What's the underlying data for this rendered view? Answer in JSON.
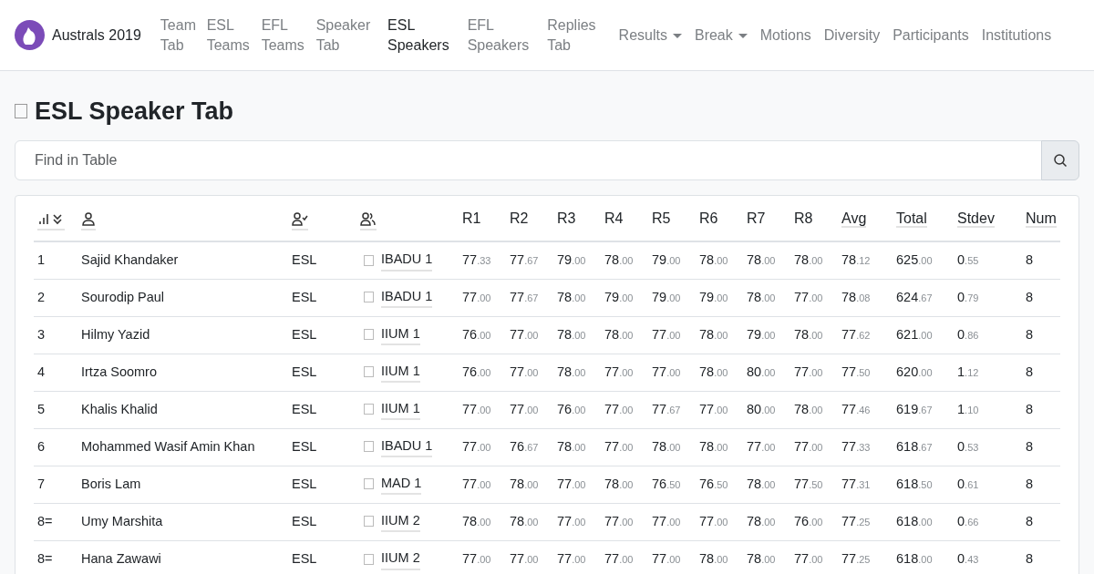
{
  "navbar": {
    "brand": "Australs 2019",
    "items": [
      {
        "label": "Team Tab",
        "selected": false,
        "dropdown": false
      },
      {
        "label": "ESL Teams",
        "selected": false,
        "dropdown": false
      },
      {
        "label": "EFL Teams",
        "selected": false,
        "dropdown": false
      },
      {
        "label": "Speaker Tab",
        "selected": false,
        "dropdown": false
      },
      {
        "label": "ESL Speakers",
        "selected": true,
        "dropdown": false
      },
      {
        "label": "EFL Speakers",
        "selected": false,
        "dropdown": false
      },
      {
        "label": "Replies Tab",
        "selected": false,
        "dropdown": false
      },
      {
        "label": "Results",
        "selected": false,
        "dropdown": true
      },
      {
        "label": "Break",
        "selected": false,
        "dropdown": true
      },
      {
        "label": "Motions",
        "selected": false,
        "dropdown": false
      },
      {
        "label": "Diversity",
        "selected": false,
        "dropdown": false
      },
      {
        "label": "Participants",
        "selected": false,
        "dropdown": false
      },
      {
        "label": "Institutions",
        "selected": false,
        "dropdown": false
      }
    ]
  },
  "title": "ESL Speaker Tab",
  "search": {
    "placeholder": "Find in Table"
  },
  "table": {
    "score_columns": [
      {
        "label": "R1",
        "has_tooltip": false
      },
      {
        "label": "R2",
        "has_tooltip": false
      },
      {
        "label": "R3",
        "has_tooltip": false
      },
      {
        "label": "R4",
        "has_tooltip": false
      },
      {
        "label": "R5",
        "has_tooltip": false
      },
      {
        "label": "R6",
        "has_tooltip": false
      },
      {
        "label": "R7",
        "has_tooltip": false
      },
      {
        "label": "R8",
        "has_tooltip": false
      },
      {
        "label": "Avg",
        "has_tooltip": true
      },
      {
        "label": "Total",
        "has_tooltip": true
      },
      {
        "label": "Stdev",
        "has_tooltip": true
      },
      {
        "label": "Num",
        "has_tooltip": true
      }
    ],
    "rows": [
      {
        "rank": "1",
        "name": "Sajid Khandaker",
        "category": "ESL",
        "team": "IBADU 1",
        "values": [
          "77.33",
          "77.67",
          "79.00",
          "78.00",
          "79.00",
          "78.00",
          "78.00",
          "78.00",
          "78.12",
          "625.00",
          "0.55",
          "8"
        ]
      },
      {
        "rank": "2",
        "name": "Sourodip Paul",
        "category": "ESL",
        "team": "IBADU 1",
        "values": [
          "77.00",
          "77.67",
          "78.00",
          "79.00",
          "79.00",
          "79.00",
          "78.00",
          "77.00",
          "78.08",
          "624.67",
          "0.79",
          "8"
        ]
      },
      {
        "rank": "3",
        "name": "Hilmy Yazid",
        "category": "ESL",
        "team": "IIUM 1",
        "values": [
          "76.00",
          "77.00",
          "78.00",
          "78.00",
          "77.00",
          "78.00",
          "79.00",
          "78.00",
          "77.62",
          "621.00",
          "0.86",
          "8"
        ]
      },
      {
        "rank": "4",
        "name": "Irtza Soomro",
        "category": "ESL",
        "team": "IIUM 1",
        "values": [
          "76.00",
          "77.00",
          "78.00",
          "77.00",
          "77.00",
          "78.00",
          "80.00",
          "77.00",
          "77.50",
          "620.00",
          "1.12",
          "8"
        ]
      },
      {
        "rank": "5",
        "name": "Khalis Khalid",
        "category": "ESL",
        "team": "IIUM 1",
        "values": [
          "77.00",
          "77.00",
          "76.00",
          "77.00",
          "77.67",
          "77.00",
          "80.00",
          "78.00",
          "77.46",
          "619.67",
          "1.10",
          "8"
        ]
      },
      {
        "rank": "6",
        "name": "Mohammed Wasif Amin Khan",
        "category": "ESL",
        "team": "IBADU 1",
        "values": [
          "77.00",
          "76.67",
          "78.00",
          "77.00",
          "78.00",
          "78.00",
          "77.00",
          "77.00",
          "77.33",
          "618.67",
          "0.53",
          "8"
        ]
      },
      {
        "rank": "7",
        "name": "Boris Lam",
        "category": "ESL",
        "team": "MAD 1",
        "values": [
          "77.00",
          "78.00",
          "77.00",
          "78.00",
          "76.50",
          "76.50",
          "78.00",
          "77.50",
          "77.31",
          "618.50",
          "0.61",
          "8"
        ]
      },
      {
        "rank": "8=",
        "name": "Umy Marshita",
        "category": "ESL",
        "team": "IIUM 2",
        "values": [
          "78.00",
          "78.00",
          "77.00",
          "77.00",
          "77.00",
          "77.00",
          "78.00",
          "76.00",
          "77.25",
          "618.00",
          "0.66",
          "8"
        ]
      },
      {
        "rank": "8=",
        "name": "Hana Zawawi",
        "category": "ESL",
        "team": "IIUM 2",
        "values": [
          "77.00",
          "77.00",
          "77.00",
          "77.00",
          "77.00",
          "78.00",
          "78.00",
          "77.00",
          "77.25",
          "618.00",
          "0.43",
          "8"
        ]
      }
    ]
  }
}
